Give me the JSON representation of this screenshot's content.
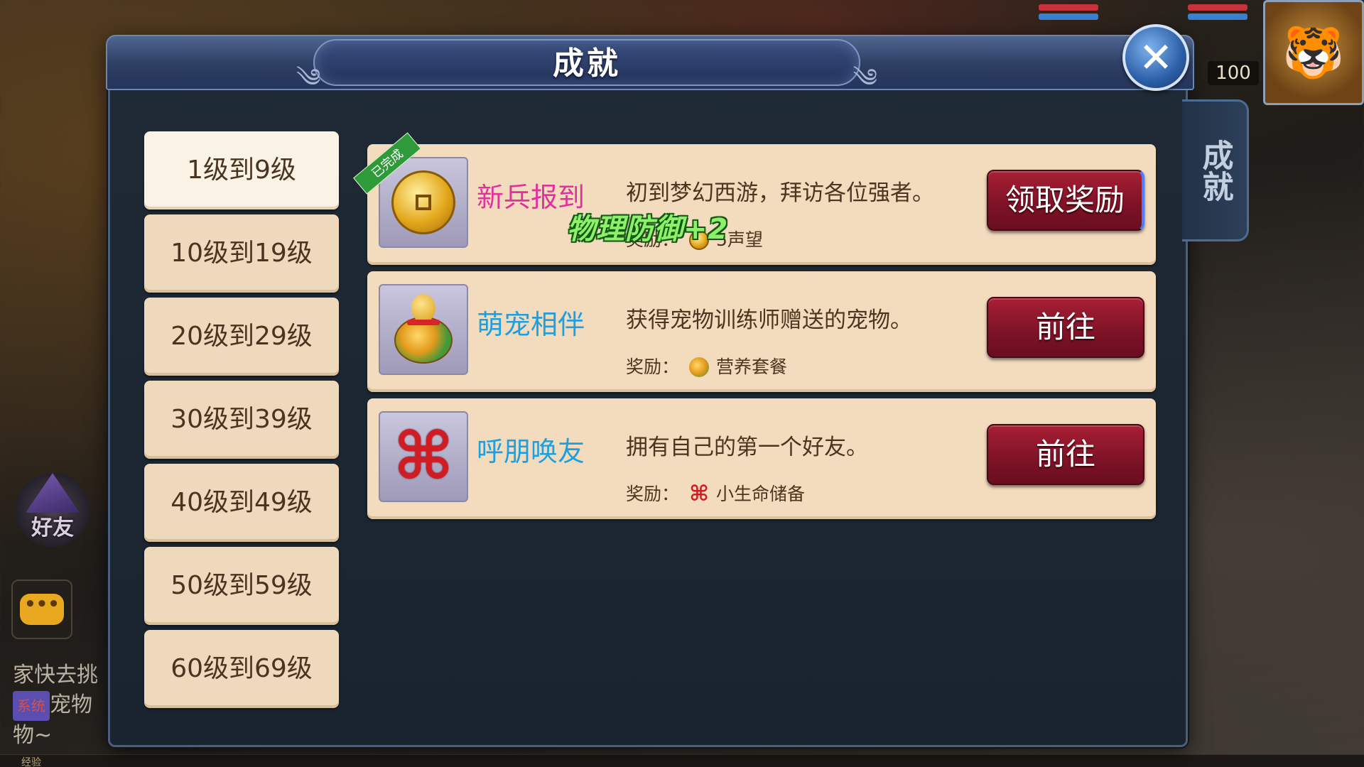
{
  "panel": {
    "title": "成就",
    "side_tab": "成就"
  },
  "levels": [
    {
      "label": "1级到9级",
      "active": true
    },
    {
      "label": "10级到19级",
      "active": false
    },
    {
      "label": "20级到29级",
      "active": false
    },
    {
      "label": "30级到39级",
      "active": false
    },
    {
      "label": "40级到49级",
      "active": false
    },
    {
      "label": "50级到59级",
      "active": false
    },
    {
      "label": "60级到69级",
      "active": false
    }
  ],
  "achievements": [
    {
      "name": "新兵报到",
      "ribbon": "已完成",
      "description": "初到梦幻西游，拜访各位强者。",
      "reward_label": "奖励：",
      "reward": "5声望",
      "button": "领取奖励",
      "icon": "coin-icon"
    },
    {
      "name": "萌宠相伴",
      "description": "获得宠物训练师赠送的宠物。",
      "reward_label": "奖励：",
      "reward": "营养套餐",
      "button": "前往",
      "icon": "gourd-icon"
    },
    {
      "name": "呼朋唤友",
      "description": "拥有自己的第一个好友。",
      "reward_label": "奖励：",
      "reward": "小生命储备",
      "button": "前往",
      "icon": "chinese-knot-icon"
    }
  ],
  "float_text": "物理防御+2",
  "background": {
    "player_level": "100",
    "friend_button": "好友",
    "chat_line1": "家快去挑",
    "chat_tag": "系统",
    "chat_line2": "宠物",
    "chat_line3": "物~",
    "exp_label": "经验"
  },
  "colors": {
    "panel_bg": "#1f2a36",
    "row_bg": "#f2dcbd",
    "button_red": "#7d1226",
    "name_pink": "#e0319e",
    "name_blue": "#1e9fe0",
    "float_green": "#8ef06a"
  }
}
